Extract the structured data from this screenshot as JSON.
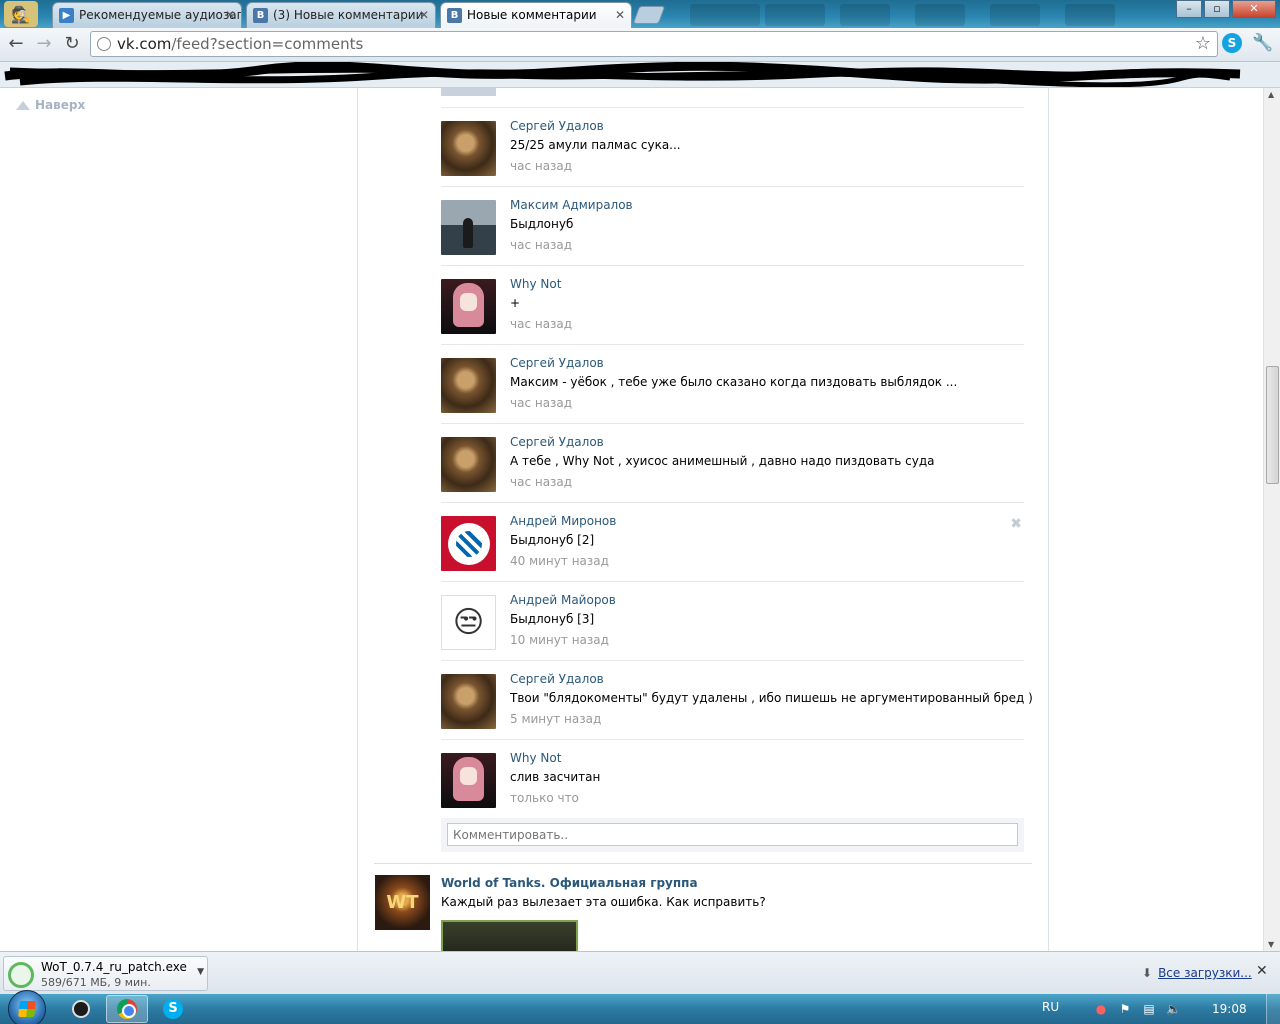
{
  "browser": {
    "tabs": [
      {
        "title": "Рекомендуемые аудиозап",
        "favicon": "play-icon",
        "favicon_color": "#3b7fc4"
      },
      {
        "title": "(3) Новые комментарии",
        "favicon": "vk-icon",
        "favicon_color": "#4a76a8"
      },
      {
        "title": "Новые комментарии",
        "favicon": "vk-icon",
        "favicon_color": "#4a76a8",
        "active": true
      }
    ],
    "url_host": "vk.com",
    "url_path": "/feed?section=comments",
    "window_controls": {
      "minimize": "–",
      "maximize": "▫",
      "close": "✕"
    }
  },
  "page": {
    "up_button": "Наверх",
    "comments": [
      {
        "author": "Сергей Удалов",
        "text": "25/25 амули палмас сука...",
        "time": "час назад",
        "avatar": "sergey"
      },
      {
        "author": "Максим Адмиралов",
        "text": "Быдлонуб",
        "time": "час назад",
        "avatar": "maksim"
      },
      {
        "author": "Why Not",
        "text": "+",
        "time": "час назад",
        "avatar": "whynot"
      },
      {
        "author": "Сергей Удалов",
        "text": "Максим - уёбок , тебе уже было сказано когда пиздовать выблядок ...",
        "time": "час назад",
        "avatar": "sergey"
      },
      {
        "author": "Сергей Удалов",
        "text": "А тебе , Why Not , хуисос анимешный , давно надо пиздовать суда",
        "time": "час назад",
        "avatar": "sergey"
      },
      {
        "author": "Андрей Миронов",
        "text": "Быдлонуб [2]",
        "time": "40 минут назад",
        "avatar": "bayern",
        "deletable": true
      },
      {
        "author": "Андрей Майоров",
        "text": "Быдлонуб [3]",
        "time": "10 минут назад",
        "avatar": "troll"
      },
      {
        "author": "Сергей Удалов",
        "text": "Твои \"блядокоменты\" будут удалены , ибо пишешь не аргументированный бред )",
        "time": "5 минут назад",
        "avatar": "sergey"
      },
      {
        "author": "Why Not",
        "text": "слив засчитан",
        "time": "только что",
        "avatar": "whynot"
      }
    ],
    "comment_placeholder": "Комментировать..",
    "next_post": {
      "author": "World of Tanks. Официальная группа",
      "text": "Каждый раз вылезает эта ошибка. Как исправить?"
    }
  },
  "downloads": {
    "file_name": "WoT_0.7.4_ru_patch.exe",
    "status": "589/671 МБ, 9 мин.",
    "all_downloads": "Все загрузки..."
  },
  "taskbar": {
    "language": "RU",
    "clock": "19:08",
    "apps": [
      "steam-icon",
      "chrome-icon",
      "skype-icon"
    ]
  },
  "colors": {
    "link": "#2b587a",
    "muted": "#999999",
    "titlebar": "#2a86b0"
  }
}
